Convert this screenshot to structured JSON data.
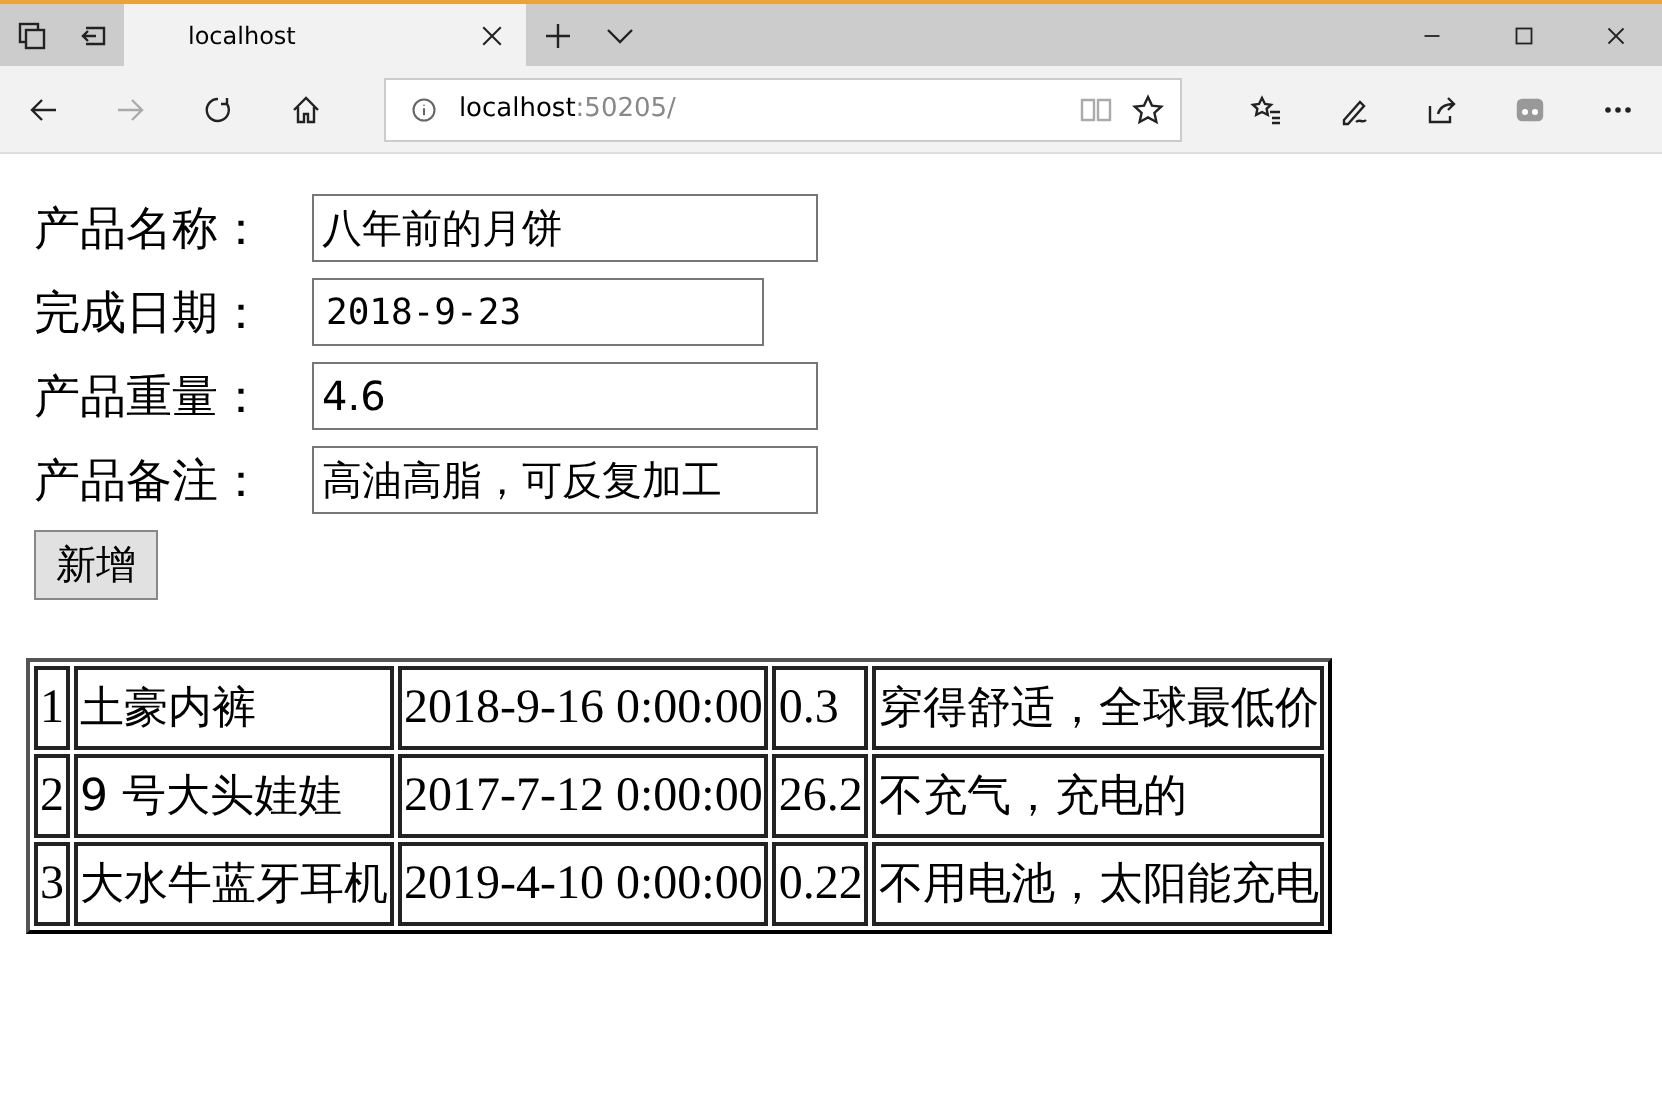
{
  "browser": {
    "tab": {
      "title": "localhost"
    },
    "address": {
      "host": "localhost",
      "rest": ":50205/"
    }
  },
  "form": {
    "fields": [
      {
        "label": "产品名称：",
        "value": "八年前的月饼",
        "kind": "text"
      },
      {
        "label": "完成日期：",
        "value": "2018-9-23",
        "kind": "date"
      },
      {
        "label": "产品重量：",
        "value": "4.6",
        "kind": "text"
      },
      {
        "label": "产品备注：",
        "value": "高油高脂，可反复加工",
        "kind": "text"
      }
    ],
    "button": "新增"
  },
  "table": {
    "rows": [
      [
        "1",
        "土豪内裤",
        "2018-9-16 0:00:00",
        "0.3",
        "穿得舒适，全球最低价"
      ],
      [
        "2",
        "9 号大头娃娃",
        "2017-7-12 0:00:00",
        "26.2",
        "不充气，充电的"
      ],
      [
        "3",
        "大水牛蓝牙耳机",
        "2019-4-10 0:00:00",
        "0.22",
        "不用电池，太阳能充电"
      ]
    ]
  }
}
